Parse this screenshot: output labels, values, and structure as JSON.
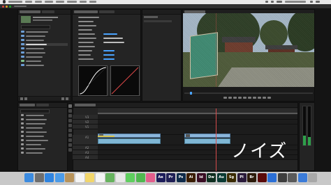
{
  "menubar": {
    "app_name": ""
  },
  "window": {
    "title": ""
  },
  "panels": {
    "project": {
      "tabs": [
        {
          "label": "",
          "active": true
        },
        {
          "label": "",
          "active": false
        }
      ],
      "items": [
        {
          "name": "",
          "selected": false
        },
        {
          "name": "",
          "selected": false
        },
        {
          "name": "",
          "selected": false
        },
        {
          "name": "",
          "selected": true
        },
        {
          "name": "",
          "selected": false
        },
        {
          "name": "",
          "selected": false
        },
        {
          "name": "",
          "selected": false
        },
        {
          "name": "",
          "selected": false
        },
        {
          "name": "",
          "selected": false
        }
      ]
    },
    "effect_controls": {
      "tabs": [
        {
          "label": "",
          "active": true
        },
        {
          "label": "",
          "active": false
        }
      ],
      "timecode": ""
    },
    "program": {
      "timecode_left": "",
      "timecode_right": ""
    },
    "timeline": {
      "timecode": "",
      "tracks": [
        {
          "name": "V3"
        },
        {
          "name": "V2"
        },
        {
          "name": "V1"
        },
        {
          "name": "A1"
        },
        {
          "name": "A2"
        },
        {
          "name": "A3"
        },
        {
          "name": "A4"
        }
      ]
    },
    "effects": {
      "tabs": [
        {
          "label": "",
          "active": true
        },
        {
          "label": "",
          "active": false
        }
      ]
    }
  },
  "overlay": {
    "caption": "ノイズ"
  },
  "dock": {
    "icons": [
      {
        "name": "finder-icon",
        "color": "#3b8be0",
        "label": ""
      },
      {
        "name": "launchpad-icon",
        "color": "#6e6e6e",
        "label": ""
      },
      {
        "name": "safari-icon",
        "color": "#2f84e0",
        "label": ""
      },
      {
        "name": "mail-icon",
        "color": "#4b9be8",
        "label": ""
      },
      {
        "name": "contacts-icon",
        "color": "#b8935a",
        "label": ""
      },
      {
        "name": "calendar-icon",
        "color": "#f4f4f4",
        "label": ""
      },
      {
        "name": "notes-icon",
        "color": "#f2d66a",
        "label": ""
      },
      {
        "name": "reminders-icon",
        "color": "#f4f4f4",
        "label": ""
      },
      {
        "name": "maps-icon",
        "color": "#66b35e",
        "label": ""
      },
      {
        "name": "photos-icon",
        "color": "#e8e8e8",
        "label": ""
      },
      {
        "name": "messages-icon",
        "color": "#5fcf5f",
        "label": ""
      },
      {
        "name": "facetime-icon",
        "color": "#4fb84f",
        "label": ""
      },
      {
        "name": "itunes-icon",
        "color": "#e35e8c",
        "label": ""
      },
      {
        "name": "after-effects-icon",
        "color": "#1c1c5a",
        "label": "Ae"
      },
      {
        "name": "premiere-icon",
        "color": "#1f1f55",
        "label": "Pr"
      },
      {
        "name": "photoshop-icon",
        "color": "#0f2b4a",
        "label": "Ps"
      },
      {
        "name": "illustrator-icon",
        "color": "#3a1d00",
        "label": "Ai"
      },
      {
        "name": "indesign-icon",
        "color": "#3a0d23",
        "label": "Id"
      },
      {
        "name": "dreamweaver-icon",
        "color": "#0e2e1f",
        "label": "Dw"
      },
      {
        "name": "audition-icon",
        "color": "#0a3a33",
        "label": "Au"
      },
      {
        "name": "speedgrade-icon",
        "color": "#3a2a00",
        "label": "Sg"
      },
      {
        "name": "prelude-icon",
        "color": "#2a1a3a",
        "label": "Pl"
      },
      {
        "name": "bridge-icon",
        "color": "#2b1a0a",
        "label": "Br"
      },
      {
        "name": "acrobat-icon",
        "color": "#5a0a0a",
        "label": ""
      },
      {
        "name": "app-icon",
        "color": "#2b6fd6",
        "label": ""
      },
      {
        "name": "app-icon",
        "color": "#3e3e3e",
        "label": ""
      },
      {
        "name": "app-icon",
        "color": "#5a5a5a",
        "label": ""
      },
      {
        "name": "app-icon",
        "color": "#3b7bd8",
        "label": ""
      },
      {
        "name": "trash-icon",
        "color": "#a8a8a8",
        "label": ""
      }
    ]
  }
}
